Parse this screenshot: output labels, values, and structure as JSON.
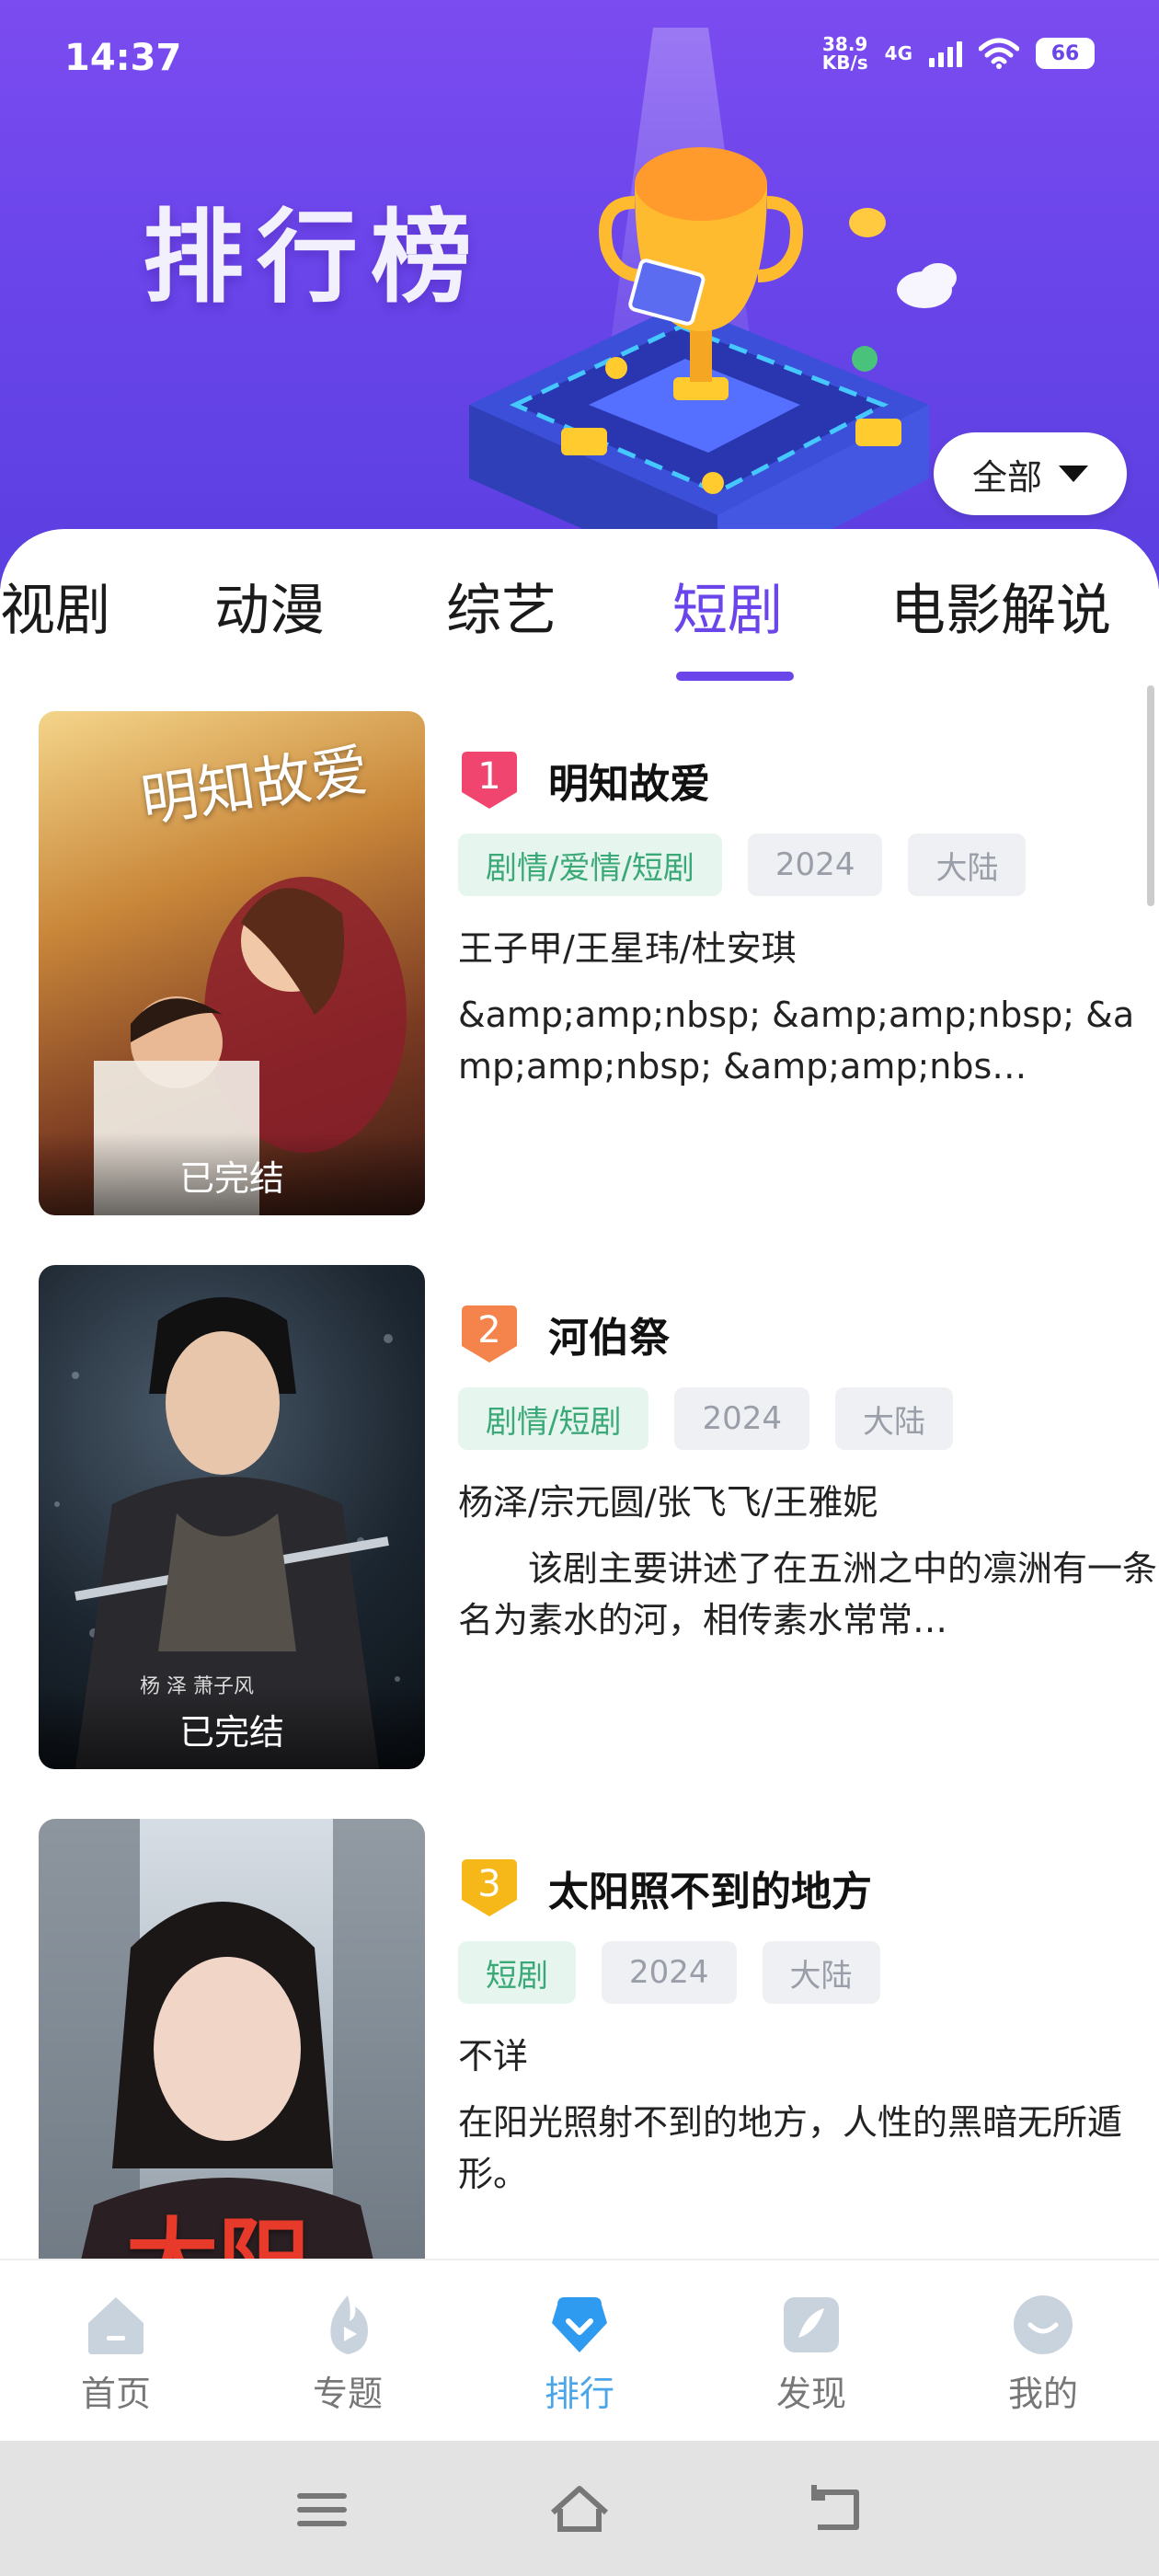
{
  "status_bar": {
    "time": "14:37",
    "net_speed": "38.9",
    "net_unit": "KB/s",
    "network": "4G",
    "battery": "66"
  },
  "header": {
    "title": "排行榜",
    "filter_label": "全部"
  },
  "tabs": [
    {
      "label": "视剧",
      "active": false
    },
    {
      "label": "动漫",
      "active": false
    },
    {
      "label": "综艺",
      "active": false
    },
    {
      "label": "短剧",
      "active": true
    },
    {
      "label": "电影解说",
      "active": false
    }
  ],
  "items": [
    {
      "rank": "1",
      "title": "明知故爱",
      "tags": [
        "剧情/爱情/短剧",
        "2024",
        "大陆"
      ],
      "cast": "王子甲/王星玮/杜安琪",
      "description": "&amp;amp;nbsp; &amp;amp;nbsp; &amp;amp;nbsp; &amp;amp;nbs…",
      "status": "已完结",
      "poster_text": "明知故爱"
    },
    {
      "rank": "2",
      "title": "河伯祭",
      "tags": [
        "剧情/短剧",
        "2024",
        "大陆"
      ],
      "cast": "杨泽/宗元圆/张飞飞/王雅妮",
      "description": "　　该剧主要讲述了在五洲之中的凛洲有一条名为素水的河，相传素水常常…",
      "status": "已完结",
      "poster_text": "杨 泽   萧子风"
    },
    {
      "rank": "3",
      "title": "太阳照不到的地方",
      "tags": [
        "短剧",
        "2024",
        "大陆"
      ],
      "cast": "不详",
      "description": "在阳光照射不到的地方，人性的黑暗无所遁形。",
      "status": "",
      "poster_text": "太阳"
    }
  ],
  "bottom_nav": [
    {
      "label": "首页",
      "icon": "home-icon",
      "active": false
    },
    {
      "label": "专题",
      "icon": "flame-play-icon",
      "active": false
    },
    {
      "label": "排行",
      "icon": "ranking-icon",
      "active": true
    },
    {
      "label": "发现",
      "icon": "discover-icon",
      "active": false
    },
    {
      "label": "我的",
      "icon": "profile-icon",
      "active": false
    }
  ],
  "colors": {
    "accent": "#6a45ea",
    "nav_active": "#4aa6e8",
    "genre_tag_text": "#3aa877",
    "rank1": "#f0456f",
    "rank2": "#f5844c",
    "rank3": "#f5b818"
  }
}
